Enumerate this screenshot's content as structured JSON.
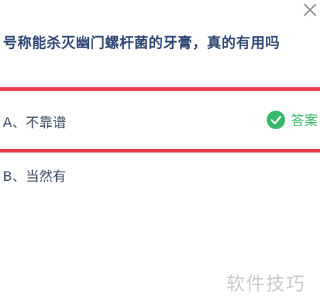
{
  "question": {
    "text": "号称能杀灭幽门螺杆菌的牙膏，真的有用吗"
  },
  "options": [
    {
      "label": "A、不靠谱",
      "is_answer": true
    },
    {
      "label": "B、当然有",
      "is_answer": false
    }
  ],
  "answer_badge": {
    "text": "答案",
    "icon": "check-circle-icon"
  },
  "close_icon": "close-icon",
  "watermark": "软件技巧",
  "colors": {
    "highlight_border": "#e8394a",
    "answer_green": "#37b86b",
    "question_text": "#2d4470",
    "option_text": "#3c4a64"
  }
}
